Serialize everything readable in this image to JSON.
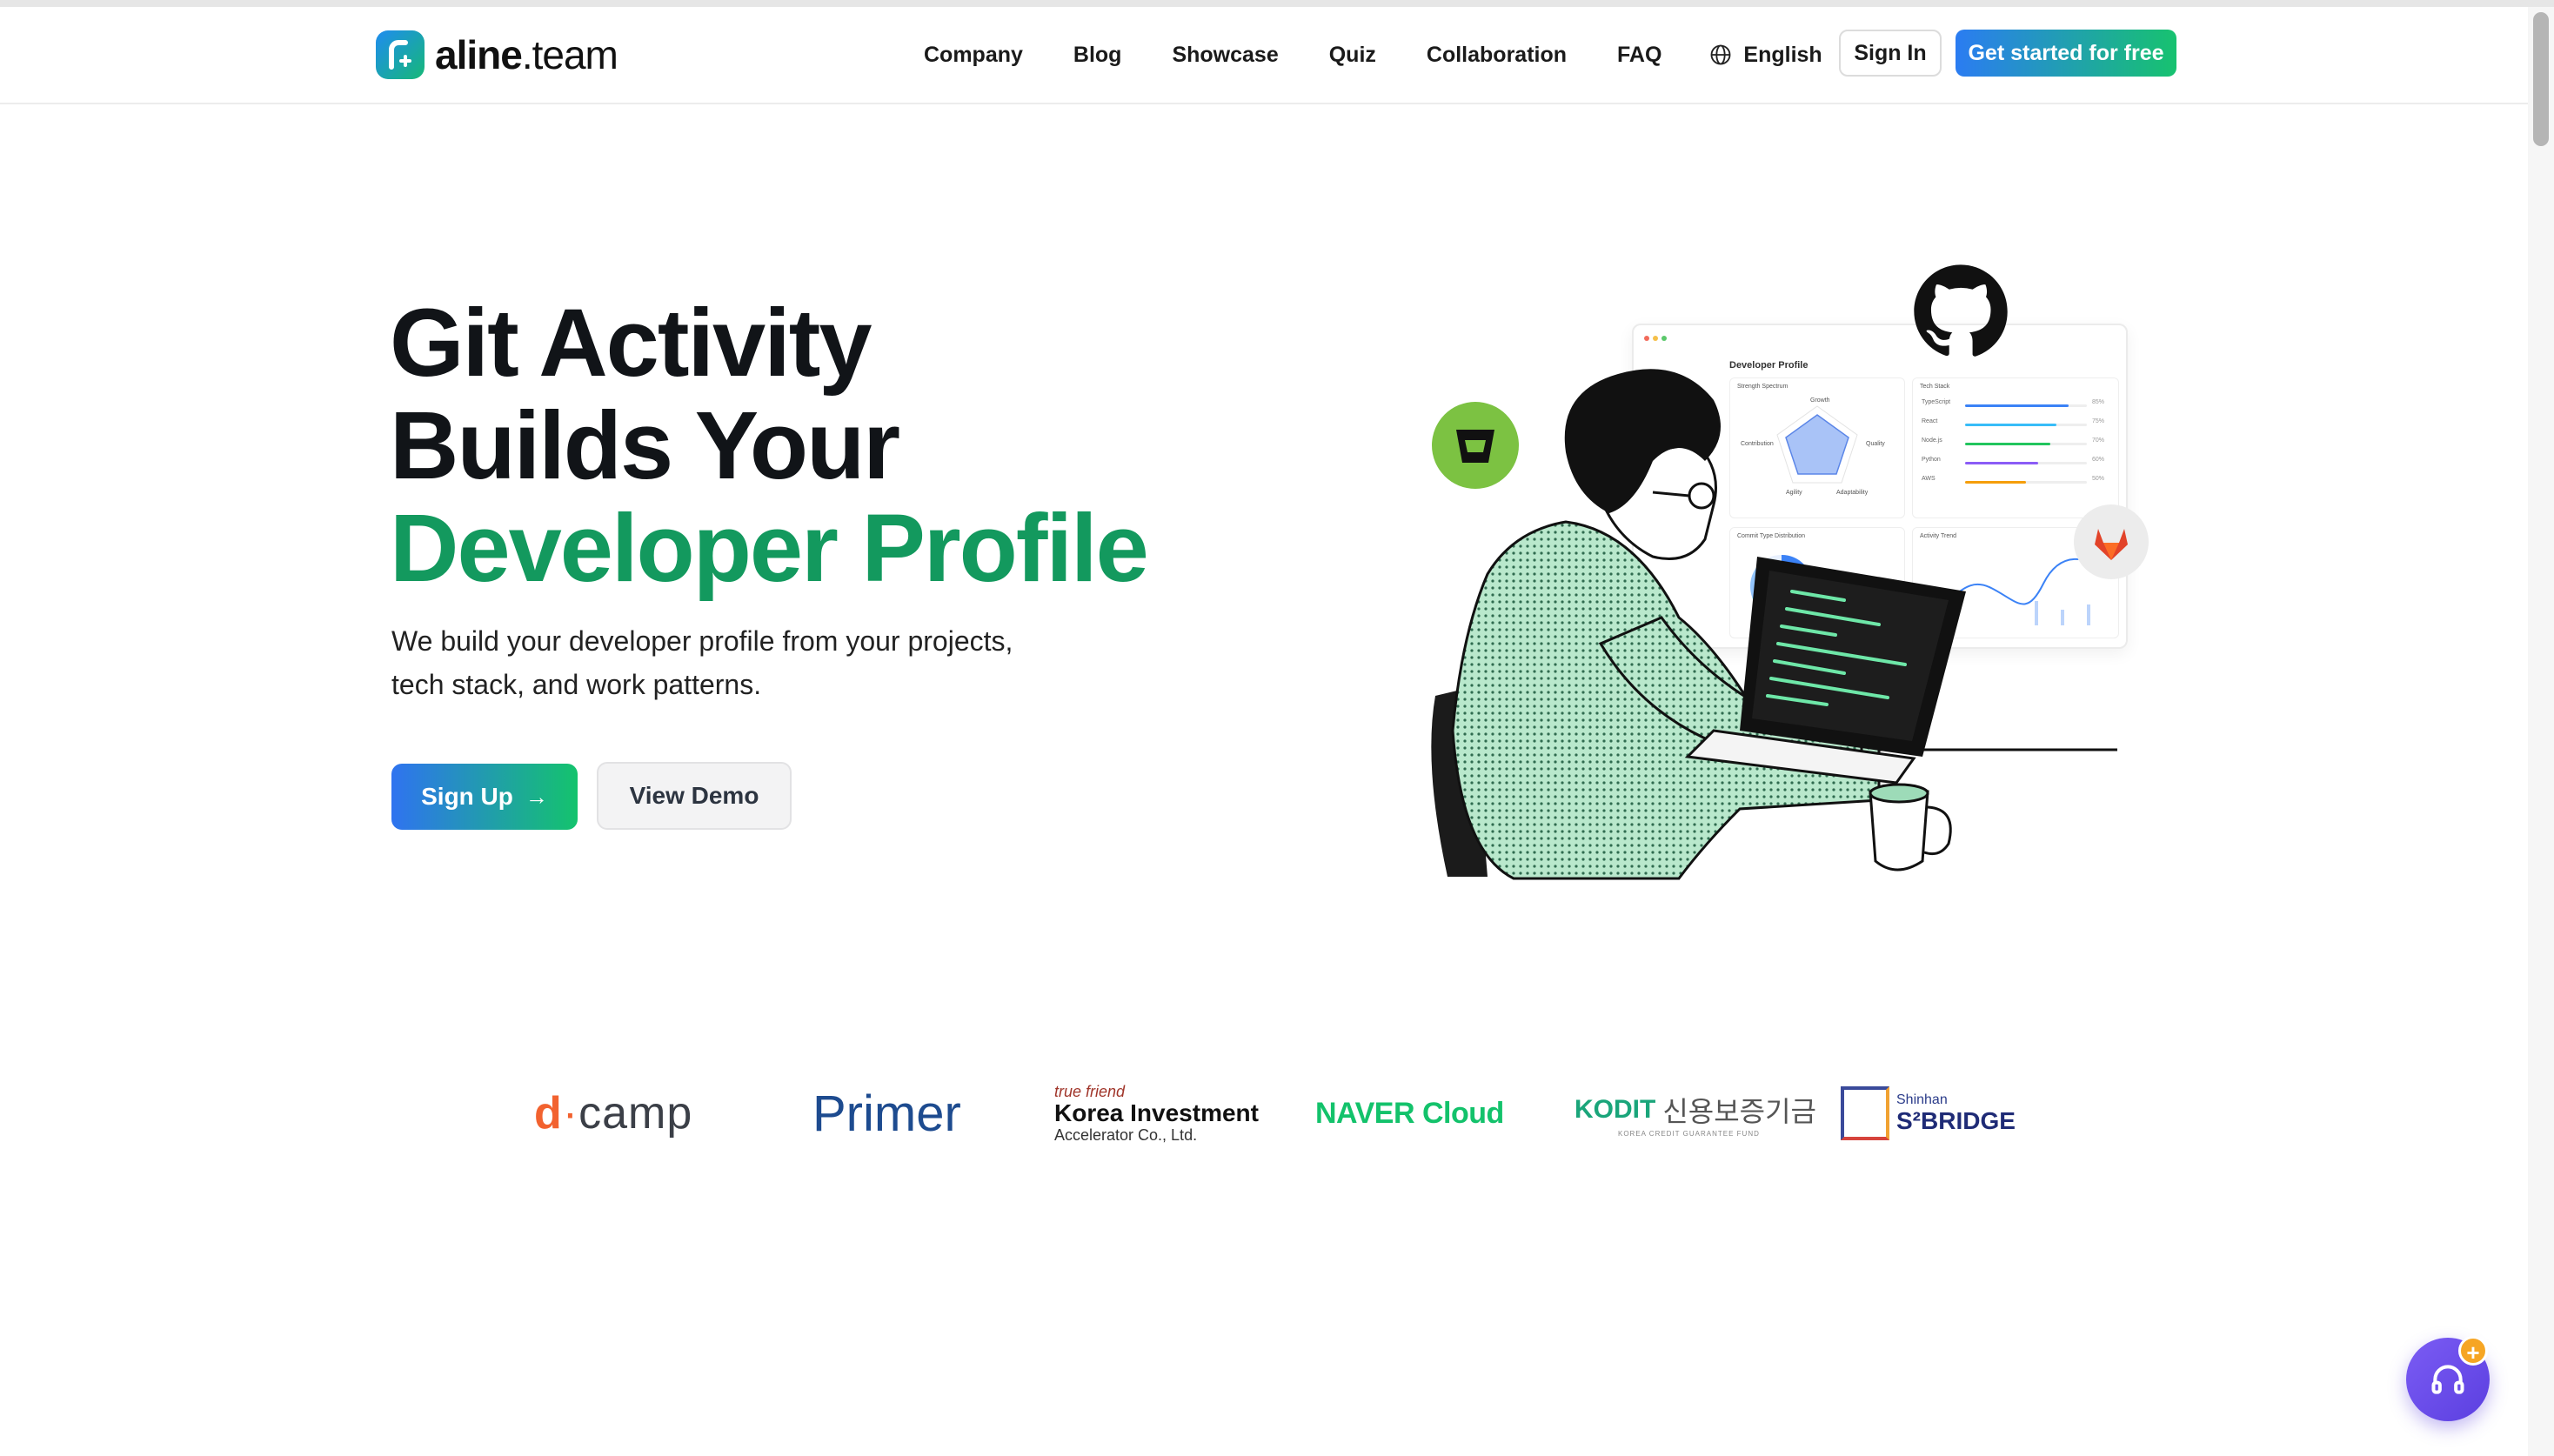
{
  "brand": {
    "name_bold": "aline",
    "name_light": ".team"
  },
  "nav": {
    "items": [
      "Company",
      "Blog",
      "Showcase",
      "Quiz",
      "Collaboration",
      "FAQ"
    ],
    "language": "English",
    "signin_label": "Sign In",
    "get_started_label": "Get started for free"
  },
  "hero": {
    "title_line1": "Git Activity",
    "title_line2": "Builds Your",
    "title_line3": "Developer Profile",
    "subtitle_line1": "We build your developer profile from your projects,",
    "subtitle_line2": "tech stack, and work patterns.",
    "signup_label": "Sign Up",
    "signup_arrow": "→",
    "demo_label": "View Demo"
  },
  "dashboard": {
    "title": "Developer Profile",
    "strength": "Strength Spectrum",
    "tech_stack": "Tech Stack",
    "commit_type": "Commit Type Distribution",
    "activity": "Activity Trend",
    "tech_rows": [
      {
        "name": "TypeScript",
        "pct": "85%",
        "value": 0.85,
        "color": "#3b82f6"
      },
      {
        "name": "React",
        "pct": "75%",
        "value": 0.75,
        "color": "#38bdf8"
      },
      {
        "name": "Node.js",
        "pct": "70%",
        "value": 0.7,
        "color": "#22c55e"
      },
      {
        "name": "Python",
        "pct": "60%",
        "value": 0.6,
        "color": "#8b5cf6"
      },
      {
        "name": "AWS",
        "pct": "50%",
        "value": 0.5,
        "color": "#f59e0b"
      }
    ],
    "radar_labels": [
      "Growth",
      "Quality",
      "Adaptability",
      "Agility",
      "Contribution"
    ]
  },
  "partners": {
    "dcamp": {
      "d": "d",
      "dot": "·",
      "rest": "camp"
    },
    "primer": "Primer",
    "kia": {
      "top": "true friend",
      "mid": "Korea Investment",
      "bot": "Accelerator Co., Ltd."
    },
    "naver": "NAVER Cloud",
    "kodit": {
      "k": "KODIT",
      "ko": "신용보증기금",
      "tiny": "KOREA CREDIT GUARANTEE FUND"
    },
    "sbridge": {
      "s1": "Shinhan",
      "s2": "S²BRIDGE"
    }
  },
  "help": {
    "badge": "+"
  },
  "colors": {
    "accent_green": "#13995e",
    "button_blue": "#2b7cf2",
    "button_green": "#17c26f",
    "help_purple": "#6b4cec"
  }
}
